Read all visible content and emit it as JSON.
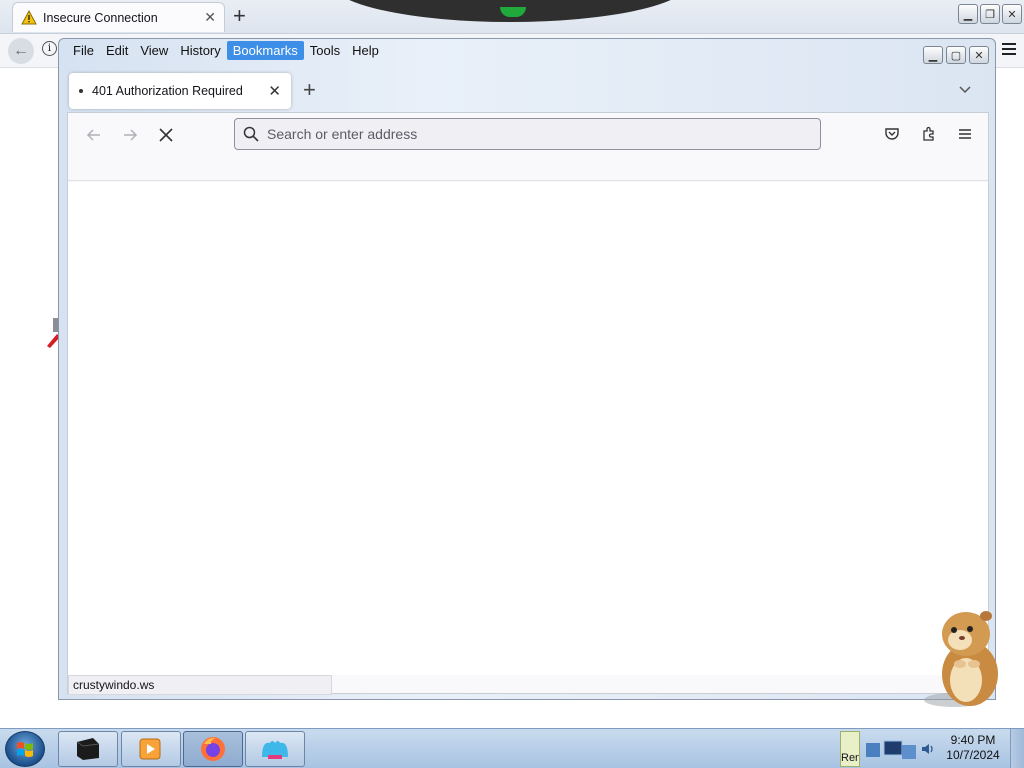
{
  "background_browser": {
    "tab_title": "Insecure Connection",
    "tab_icon": "warning-icon",
    "newtab_icon": "plus-icon"
  },
  "window": {
    "menu": [
      {
        "label": "File",
        "active": false
      },
      {
        "label": "Edit",
        "active": false
      },
      {
        "label": "View",
        "active": false
      },
      {
        "label": "History",
        "active": false
      },
      {
        "label": "Bookmarks",
        "active": true
      },
      {
        "label": "Tools",
        "active": false
      },
      {
        "label": "Help",
        "active": false
      }
    ],
    "tab": {
      "title": "401 Authorization Required",
      "close_icon": "close-icon"
    },
    "newtab_icon": "plus-icon",
    "toolbar": {
      "back_icon": "back-arrow-icon",
      "forward_icon": "forward-arrow-icon",
      "stop_icon": "stop-icon",
      "search_placeholder": "Search or enter address",
      "pocket_icon": "pocket-icon",
      "extensions_icon": "extensions-icon",
      "menu_icon": "hamburger-menu-icon"
    },
    "status_text": "crustywindo.ws"
  },
  "taskbar": {
    "clock_time": "9:40 PM",
    "clock_date": "10/7/2024",
    "tray_label": "Ren",
    "accent": "#3d8ee6"
  }
}
